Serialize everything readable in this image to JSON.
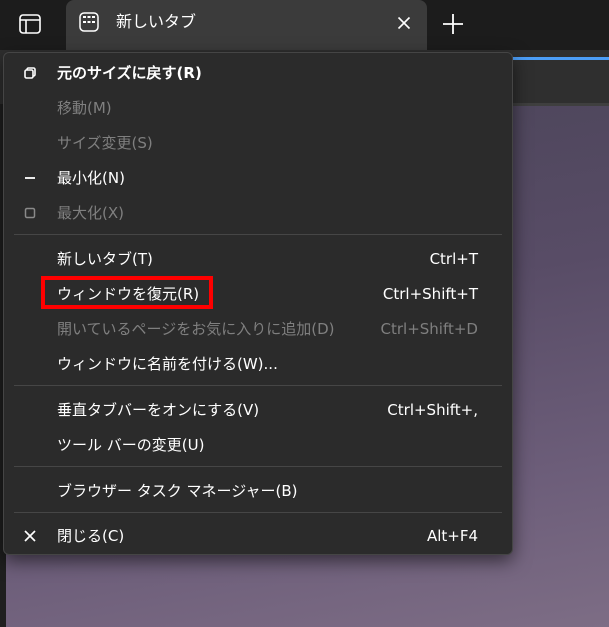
{
  "tab": {
    "title": "新しいタブ"
  },
  "menu": {
    "items": [
      {
        "label": "元のサイズに戻す(R)",
        "shortcut": ""
      },
      {
        "label": "移動(M)",
        "shortcut": ""
      },
      {
        "label": "サイズ変更(S)",
        "shortcut": ""
      },
      {
        "label": "最小化(N)",
        "shortcut": ""
      },
      {
        "label": "最大化(X)",
        "shortcut": ""
      },
      {
        "label": "新しいタブ(T)",
        "shortcut": "Ctrl+T"
      },
      {
        "label": "ウィンドウを復元(R)",
        "shortcut": "Ctrl+Shift+T"
      },
      {
        "label": "開いているページをお気に入りに追加(D)",
        "shortcut": "Ctrl+Shift+D"
      },
      {
        "label": "ウィンドウに名前を付ける(W)...",
        "shortcut": ""
      },
      {
        "label": "垂直タブバーをオンにする(V)",
        "shortcut": "Ctrl+Shift+,"
      },
      {
        "label": "ツール バーの変更(U)",
        "shortcut": ""
      },
      {
        "label": "ブラウザー タスク マネージャー(B)",
        "shortcut": ""
      },
      {
        "label": "閉じる(C)",
        "shortcut": "Alt+F4"
      }
    ]
  },
  "colors": {
    "menu_bg": "#2b2b2b",
    "disabled_text": "#7f7f7f",
    "highlight": "#ff0000",
    "accent": "#4c9ef7"
  }
}
